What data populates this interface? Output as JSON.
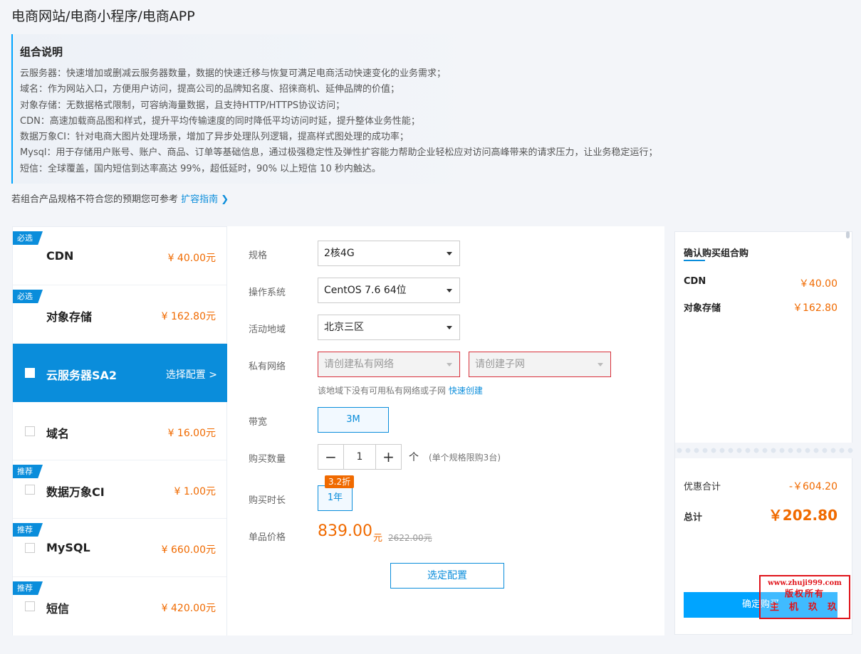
{
  "page": {
    "title": "电商网站/电商小程序/电商APP"
  },
  "description": {
    "title": "组合说明",
    "lines": [
      "云服务器：快速增加或删减云服务器数量，数据的快速迁移与恢复可满足电商活动快速变化的业务需求；",
      "域名：作为网站入口，方便用户访问，提高公司的品牌知名度、招徕商机、延伸品牌的价值；",
      "对象存储：无数据格式限制，可容纳海量数据，且支持HTTP/HTTPS协议访问；",
      "CDN：高速加载商品图和样式，提升平均传输速度的同时降低平均访问时延，提升整体业务性能；",
      "数据万象CI：针对电商大图片处理场景，增加了异步处理队列逻辑，提高样式图处理的成功率；",
      "Mysql：用于存储用户账号、账户、商品、订单等基础信息，通过极强稳定性及弹性扩容能力帮助企业轻松应对访问高峰带来的请求压力，让业务稳定运行；",
      "短信：全球覆盖，国内短信到达率高达 99%，超低延时，90% 以上短信 10 秒内触达。"
    ]
  },
  "hint": {
    "text": "若组合产品规格不符合您的预期您可参考",
    "link": "扩容指南 ❯"
  },
  "products": [
    {
      "badge": "必选",
      "name": "CDN",
      "price": "¥ 40.00元"
    },
    {
      "badge": "必选",
      "name": "对象存储",
      "price": "¥ 162.80元"
    },
    {
      "badge": "",
      "name": "云服务器SA2",
      "action": "选择配置 >"
    },
    {
      "badge": "",
      "name": "域名",
      "price": "¥ 16.00元"
    },
    {
      "badge": "推荐",
      "name": "数据万象CI",
      "price": "¥ 1.00元"
    },
    {
      "badge": "推荐",
      "name": "MySQL",
      "price": "¥ 660.00元"
    },
    {
      "badge": "推荐",
      "name": "短信",
      "price": "¥ 420.00元"
    }
  ],
  "config": {
    "spec_label": "规格",
    "spec_value": "2核4G",
    "os_label": "操作系统",
    "os_value": "CentOS 7.6 64位",
    "region_label": "活动地域",
    "region_value": "北京三区",
    "vpc_label": "私有网络",
    "vpc_placeholder": "请创建私有网络",
    "subnet_placeholder": "请创建子网",
    "vpc_hint": "该地域下没有可用私有网络或子网",
    "vpc_link": "快速创建",
    "bandwidth_label": "带宽",
    "bandwidth_value": "3M",
    "qty_label": "购买数量",
    "qty_minus": "−",
    "qty_value": "1",
    "qty_plus": "+",
    "qty_unit": "个",
    "qty_limit": "(单个规格限购3台)",
    "duration_label": "购买时长",
    "duration_value": "1年",
    "duration_discount": "3.2折",
    "unit_price_label": "单品价格",
    "unit_price": "839.00",
    "unit_price_unit": "元",
    "unit_price_old": "2622.00元",
    "select_button": "选定配置"
  },
  "cart": {
    "title": "确认购买组合购",
    "items": [
      {
        "name": "CDN",
        "price": "￥40.00"
      },
      {
        "name": "对象存储",
        "price": "￥162.80"
      }
    ],
    "discount_label": "优惠合计",
    "discount_value": "-￥604.20",
    "total_label": "总计",
    "total_value": "￥202.80",
    "buy_button": "确定购买"
  },
  "watermark": {
    "line1": "www.zhuji999.com",
    "line2": "版权所有",
    "line3": "主机玖玖"
  },
  "colors": {
    "accent": "#0a8ddb",
    "price": "#f06a00",
    "error": "#d8303a"
  }
}
